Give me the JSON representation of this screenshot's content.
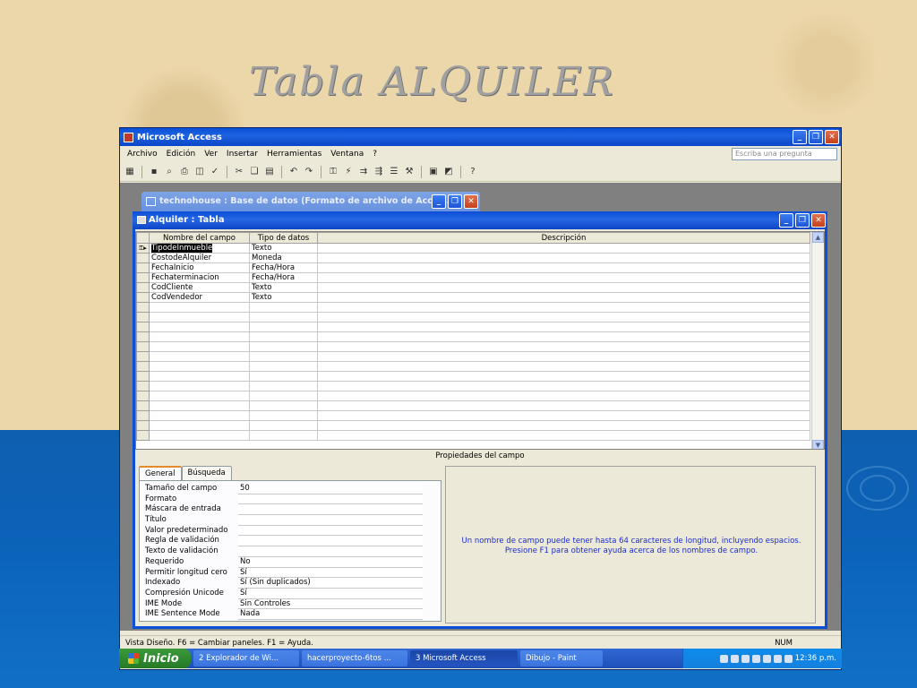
{
  "slide": {
    "title": "Tabla ALQUILER"
  },
  "app": {
    "title": "Microsoft Access",
    "menu": [
      "Archivo",
      "Edición",
      "Ver",
      "Insertar",
      "Herramientas",
      "Ventana",
      "?"
    ],
    "ask_placeholder": "Escriba una pregunta"
  },
  "db_window": {
    "title": "technohouse : Base de datos (Formato de archivo de Acces..."
  },
  "table_window": {
    "title": "Alquiler : Tabla",
    "columns": [
      "Nombre del campo",
      "Tipo de datos",
      "Descripción"
    ],
    "rows": [
      {
        "name": "TipodeInmueble",
        "type": "Texto",
        "desc": ""
      },
      {
        "name": "CostodeAlquiler",
        "type": "Moneda",
        "desc": ""
      },
      {
        "name": "FechaInicio",
        "type": "Fecha/Hora",
        "desc": ""
      },
      {
        "name": "Fechaterminacion",
        "type": "Fecha/Hora",
        "desc": ""
      },
      {
        "name": "CodCliente",
        "type": "Texto",
        "desc": ""
      },
      {
        "name": "CodVendedor",
        "type": "Texto",
        "desc": ""
      }
    ],
    "props_label": "Propiedades del campo",
    "tabs": [
      "General",
      "Búsqueda"
    ],
    "properties": [
      {
        "label": "Tamaño del campo",
        "value": "50"
      },
      {
        "label": "Formato",
        "value": ""
      },
      {
        "label": "Máscara de entrada",
        "value": ""
      },
      {
        "label": "Título",
        "value": ""
      },
      {
        "label": "Valor predeterminado",
        "value": ""
      },
      {
        "label": "Regla de validación",
        "value": ""
      },
      {
        "label": "Texto de validación",
        "value": ""
      },
      {
        "label": "Requerido",
        "value": "No"
      },
      {
        "label": "Permitir longitud cero",
        "value": "Sí"
      },
      {
        "label": "Indexado",
        "value": "Sí (Sin duplicados)"
      },
      {
        "label": "Compresión Unicode",
        "value": "Sí"
      },
      {
        "label": "IME Mode",
        "value": "Sin Controles"
      },
      {
        "label": "IME Sentence Mode",
        "value": "Nada"
      }
    ],
    "help_text": "Un nombre de campo puede tener hasta 64 caracteres de longitud, incluyendo espacios. Presione F1 para obtener ayuda acerca de los nombres de campo."
  },
  "status": {
    "text": "Vista Diseño.  F6 = Cambiar paneles.  F1 = Ayuda.",
    "num": "NUM"
  },
  "taskbar": {
    "start": "Inicio",
    "tasks": [
      "2 Explorador de Wi...",
      "hacerproyecto-6tos ...",
      "3 Microsoft Access",
      "Dibujo - Paint"
    ],
    "clock": "12:36 p.m."
  }
}
